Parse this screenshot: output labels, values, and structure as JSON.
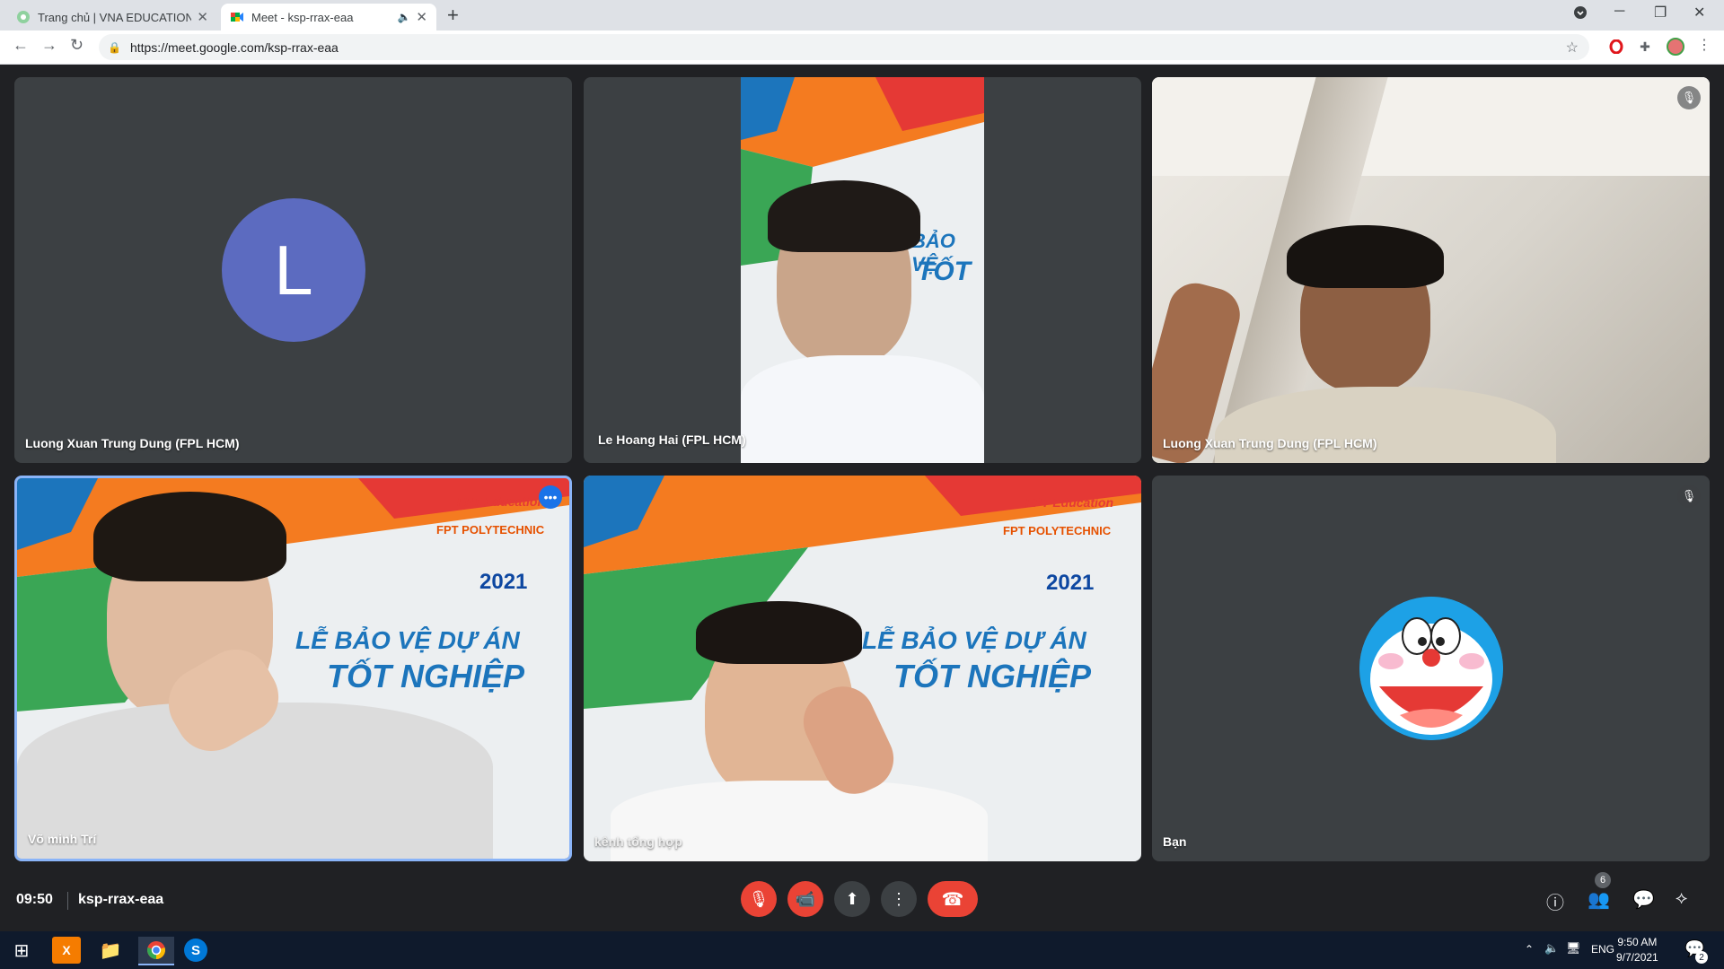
{
  "browser": {
    "tabs": [
      {
        "title": "Trang chủ | VNA EDUCATION",
        "active": false
      },
      {
        "title": "Meet - ksp-rrax-eaa",
        "active": true
      }
    ],
    "url": "https://meet.google.com/ksp-rrax-eaa"
  },
  "meet": {
    "participants": [
      {
        "name": "Luong Xuan Trung Dung (FPL HCM)",
        "avatar_letter": "L",
        "video": false
      },
      {
        "name": "Le Hoang Hai (FPL HCM)",
        "video": true
      },
      {
        "name": "Luong Xuan Trung Dung (FPL HCM)",
        "video": true,
        "muted": true
      },
      {
        "name": "Võ minh Trí",
        "video": true,
        "active_speaker": true
      },
      {
        "name": "kênh tổng hợp",
        "video": true
      },
      {
        "name": "Bạn",
        "video": false,
        "muted": true
      }
    ],
    "banner": {
      "brand": "FPT Education",
      "school": "FPT POLYTECHNIC",
      "year": "2021",
      "line1": "LỄ BẢO VỆ DỰ ÁN",
      "line2": "TỐT NGHIỆP",
      "partial1": "BẢO VỆ",
      "partial2": "TỐT"
    },
    "time": "09:50",
    "meeting_code": "ksp-rrax-eaa",
    "participant_count": "6"
  },
  "taskbar": {
    "lang": "ENG",
    "time": "9:50 AM",
    "date": "9/7/2021",
    "notifications": "2"
  },
  "colors": {
    "accent": "#8ab4f8",
    "red": "#ea4335",
    "avatar": "#5c6bc0"
  }
}
